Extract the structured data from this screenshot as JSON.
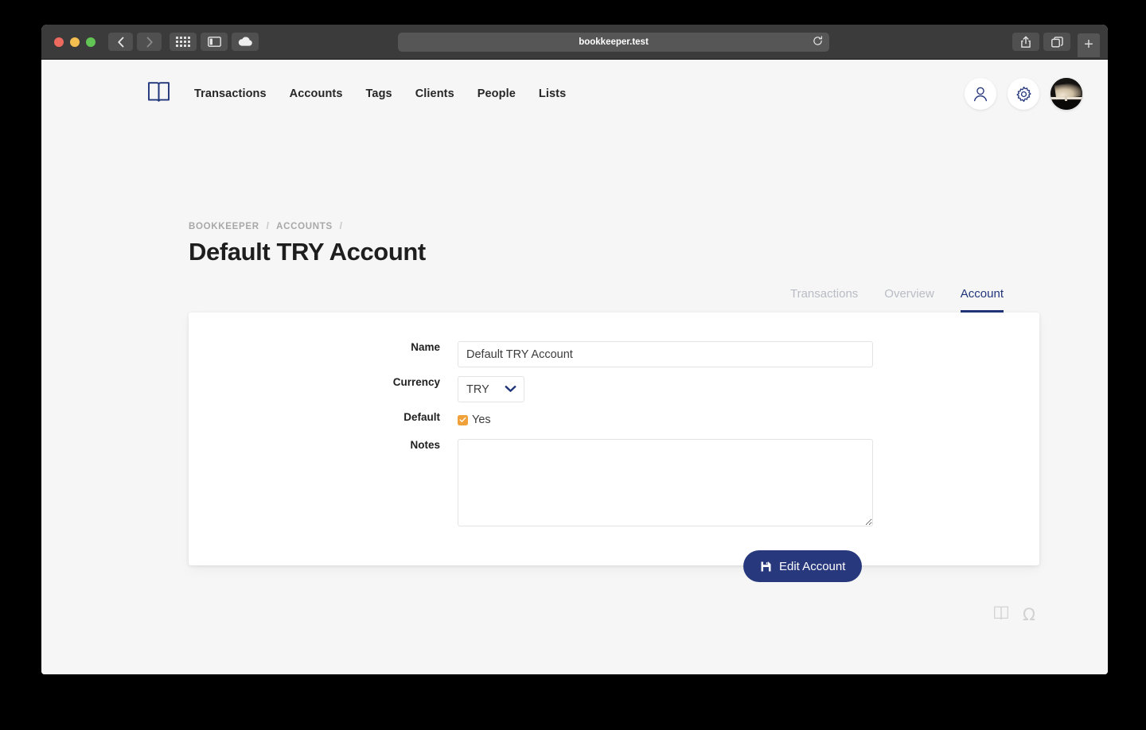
{
  "browser": {
    "url": "bookkeeper.test",
    "back_icon": "chevron-left-icon",
    "forward_icon": "chevron-right-icon",
    "grid_icon": "grid-icon",
    "sidebar_icon": "sidebar-icon",
    "cloud_icon": "cloud-icon",
    "reload_icon": "reload-icon",
    "share_icon": "share-icon",
    "tabs_icon": "tabs-overview-icon",
    "newtab_label": "+"
  },
  "nav": {
    "logo_icon": "open-book-logo",
    "links": [
      {
        "label": "Transactions"
      },
      {
        "label": "Accounts"
      },
      {
        "label": "Tags"
      },
      {
        "label": "Clients"
      },
      {
        "label": "People"
      },
      {
        "label": "Lists"
      }
    ],
    "actions": {
      "person_icon": "person-icon",
      "settings_icon": "gear-icon",
      "avatar": "user-avatar"
    }
  },
  "breadcrumb": {
    "items": [
      "BOOKKEEPER",
      "ACCOUNTS"
    ],
    "separator": "/"
  },
  "page": {
    "title": "Default TRY Account"
  },
  "tabs": [
    {
      "label": "Transactions",
      "active": false
    },
    {
      "label": "Overview",
      "active": false
    },
    {
      "label": "Account",
      "active": true
    }
  ],
  "form": {
    "name": {
      "label": "Name",
      "value": "Default TRY Account",
      "placeholder": ""
    },
    "currency": {
      "label": "Currency",
      "value": "TRY",
      "chevron_icon": "chevron-down-icon"
    },
    "default": {
      "label": "Default",
      "checked": true,
      "option_label": "Yes"
    },
    "notes": {
      "label": "Notes",
      "value": "",
      "placeholder": ""
    },
    "submit": {
      "label": "Edit Account",
      "icon": "save-icon"
    }
  },
  "footer": {
    "book_icon": "open-book-icon",
    "omega_icon": "Ω"
  },
  "colors": {
    "accent": "#21357a",
    "button": "#27387d",
    "checkbox": "#f0a13a",
    "page_bg": "#f6f6f6",
    "card_bg": "#ffffff",
    "muted_text": "#b9bcc4"
  }
}
